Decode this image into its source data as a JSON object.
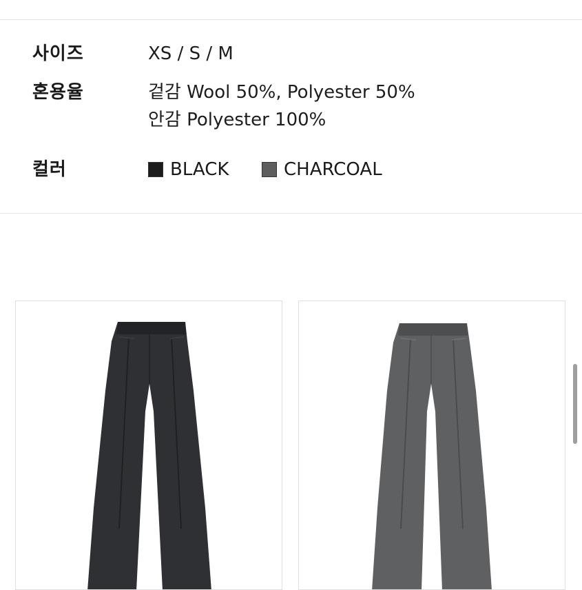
{
  "specs": {
    "size": {
      "label": "사이즈",
      "value": "XS / S / M"
    },
    "material": {
      "label": "혼용율",
      "lines": [
        "겉감 Wool 50%, Polyester 50%",
        "안감 Polyester 100%"
      ]
    },
    "color": {
      "label": "컬러",
      "options": [
        {
          "name": "BLACK",
          "swatch": "#1c1c1c"
        },
        {
          "name": "CHARCOAL",
          "swatch": "#5e5e5e"
        }
      ]
    }
  },
  "products": [
    {
      "color": "#2f3033",
      "shade": "#222326"
    },
    {
      "color": "#5f6062",
      "shade": "#4d4e50"
    }
  ]
}
